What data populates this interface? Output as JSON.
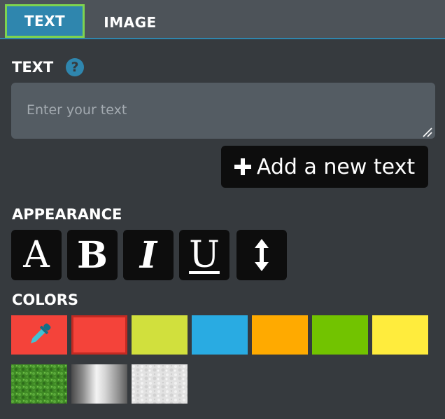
{
  "tabs": [
    {
      "label": "TEXT",
      "active": true
    },
    {
      "label": "IMAGE",
      "active": false
    }
  ],
  "text_section": {
    "label": "TEXT",
    "help_icon": "question-circle-icon",
    "input_value": "",
    "placeholder": "Enter your text",
    "add_button_label": "Add a new text"
  },
  "appearance": {
    "label": "APPEARANCE",
    "buttons": [
      {
        "name": "font-family-button",
        "glyph": "A"
      },
      {
        "name": "bold-button",
        "glyph": "B"
      },
      {
        "name": "italic-button",
        "glyph": "I"
      },
      {
        "name": "underline-button",
        "glyph": "U"
      },
      {
        "name": "line-height-button",
        "glyph": "↕"
      }
    ]
  },
  "colors": {
    "label": "COLORS",
    "swatches": [
      {
        "name": "eyedropper",
        "color": "#f4433a",
        "icon": "eyedropper-icon"
      },
      {
        "name": "red",
        "color": "#f4433a",
        "selected": true
      },
      {
        "name": "lime",
        "color": "#d1e03d"
      },
      {
        "name": "sky-blue",
        "color": "#29abe2"
      },
      {
        "name": "orange",
        "color": "#ffaa00"
      },
      {
        "name": "green",
        "color": "#72c300"
      },
      {
        "name": "yellow",
        "color": "#ffec3d"
      },
      {
        "name": "grass-texture",
        "color": "#3f8a25"
      },
      {
        "name": "chrome-texture",
        "color": "#b5b5b5"
      },
      {
        "name": "white-texture",
        "color": "#e2e2e2"
      }
    ]
  },
  "theme": {
    "background": "#363a3e",
    "tab_bar": "#4d5359",
    "accent_blue": "#2f86ae",
    "active_tab_border": "#7ed34f",
    "input_background": "#545c63",
    "button_black": "#0d0d0d"
  }
}
